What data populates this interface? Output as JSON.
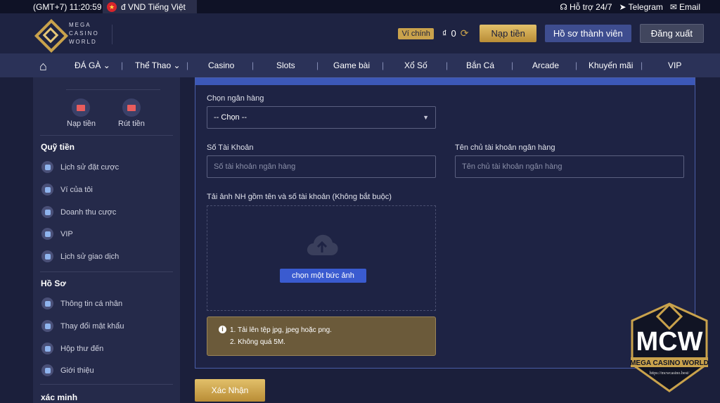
{
  "topbar": {
    "time": "(GMT+7) 11:20:59",
    "currency_lang": "đ VND Tiếng Việt",
    "support": "Hỗ trợ 24/7",
    "telegram": "Telegram",
    "email": "Email"
  },
  "header": {
    "logo_line1": "MEGA",
    "logo_line2": "CASINO",
    "logo_line3": "WORLD",
    "wallet_tag": "Ví chính",
    "currency_symbol": "₫",
    "balance": "0",
    "deposit": "Nạp tiền",
    "profile": "Hồ sơ thành viên",
    "logout": "Đăng xuất"
  },
  "nav": {
    "items": [
      "ĐÁ GÀ",
      "Thể Thao",
      "Casino",
      "Slots",
      "Game bài",
      "Xổ Số",
      "Bắn Cá",
      "Arcade",
      "Khuyến mãi",
      "VIP"
    ]
  },
  "sidebar": {
    "quick_deposit": "Nạp tiền",
    "quick_withdraw": "Rút tiền",
    "section_funds": "Quỹ tiền",
    "funds": [
      "Lịch sử đặt cược",
      "Ví của tôi",
      "Doanh thu cược",
      "VIP",
      "Lịch sử giao dịch"
    ],
    "section_profile": "Hồ Sơ",
    "profile": [
      "Thông tin cá nhân",
      "Thay đổi mật khẩu",
      "Hộp thư đến",
      "Giới thiệu"
    ],
    "section_verify": "xác minh"
  },
  "form": {
    "bank_label": "Chọn ngân hàng",
    "bank_value": "-- Chọn --",
    "account_label": "Số Tài Khoản",
    "account_placeholder": "Số tài khoản ngân hàng",
    "holder_label": "Tên chủ tài khoản ngân hàng",
    "holder_placeholder": "Tên chủ tài khoản ngân hàng",
    "upload_label": "Tải ảnh NH gồm tên và số tài khoản (Không bắt buộc)",
    "upload_button": "chọn một bức ảnh",
    "note1": "1. Tải lên tệp jpg, jpeg hoặc png.",
    "note2": "2. Không quá 5M.",
    "confirm": "Xác Nhận"
  },
  "watermark": {
    "big": "MCW",
    "sub": "MEGA CASINO WORLD",
    "url": "https://mcwcasino.best/"
  },
  "colors": {
    "gold": "#c9a24c",
    "accent_blue": "#3a5bd0",
    "bg": "#1b1f3b"
  }
}
